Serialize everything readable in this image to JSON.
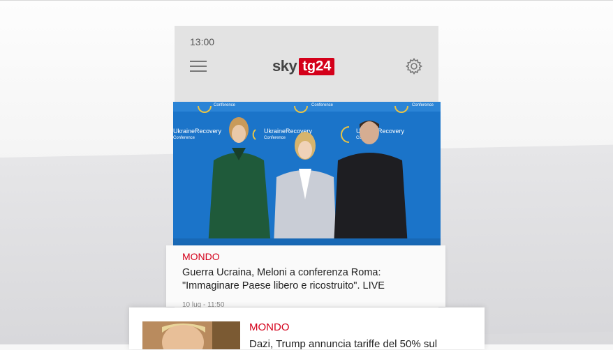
{
  "status_bar": {
    "time": "13:00"
  },
  "header": {
    "logo_sky": "sky",
    "logo_tg": "tg24",
    "menu_icon": "hamburger-menu-icon",
    "settings_icon": "gear-icon"
  },
  "hero": {
    "banner_text": "UkraineRecovery",
    "banner_sub": "Conference"
  },
  "articles": [
    {
      "section": "MONDO",
      "headline": "Guerra Ucraina, Meloni a conferenza Roma: \"Immaginare Paese libero e ricostruito\". LIVE",
      "timestamp": "10 lug - 11:50"
    },
    {
      "section": "MONDO",
      "headline": "Dazi, Trump annuncia tariffe del 50% sul"
    }
  ],
  "colors": {
    "brand_red": "#d4001a",
    "hero_blue": "#1a74c8"
  }
}
